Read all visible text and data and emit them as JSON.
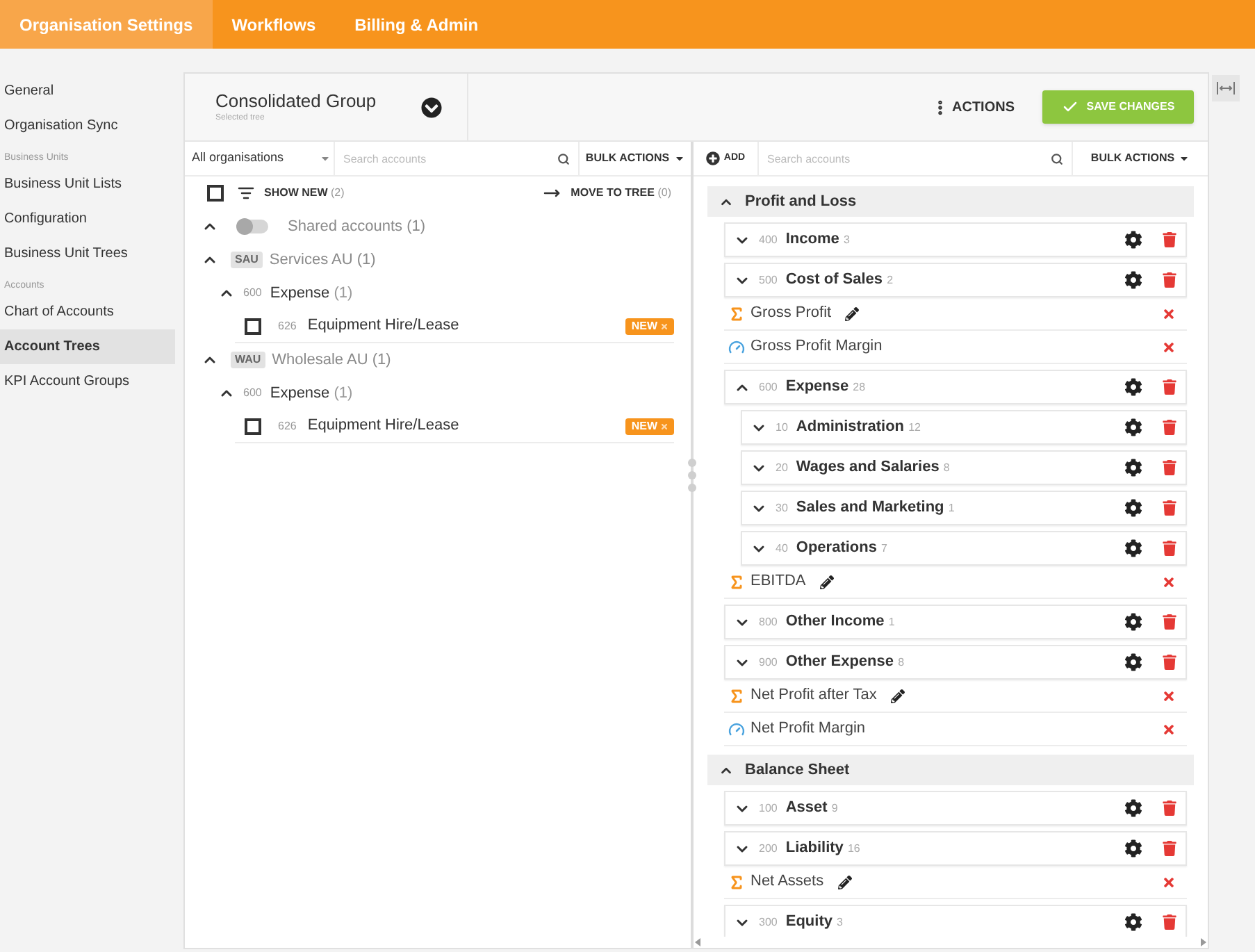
{
  "top_nav": [
    {
      "label": "Organisation Settings",
      "selected": true
    },
    {
      "label": "Workflows",
      "selected": false
    },
    {
      "label": "Billing & Admin",
      "selected": false
    }
  ],
  "sidebar": [
    {
      "kind": "item",
      "label": "General",
      "selected": false
    },
    {
      "kind": "item",
      "label": "Organisation Sync",
      "selected": false
    },
    {
      "kind": "heading",
      "label": "Business Units"
    },
    {
      "kind": "item",
      "label": "Business Unit Lists",
      "selected": false
    },
    {
      "kind": "item",
      "label": "Configuration",
      "selected": false
    },
    {
      "kind": "item",
      "label": "Business Unit Trees",
      "selected": false
    },
    {
      "kind": "heading",
      "label": "Accounts"
    },
    {
      "kind": "item",
      "label": "Chart of Accounts",
      "selected": false
    },
    {
      "kind": "item",
      "label": "Account Trees",
      "selected": true
    },
    {
      "kind": "item",
      "label": "KPI Account Groups",
      "selected": false
    }
  ],
  "tree_selector": {
    "title": "Consolidated Group",
    "subtitle": "Selected tree"
  },
  "header_actions": {
    "actions": "ACTIONS",
    "save": "SAVE CHANGES"
  },
  "left_pane": {
    "org_filter": "All organisations",
    "search": {
      "placeholder": "Search accounts"
    },
    "bulk_actions": "BULK ACTIONS",
    "show_new": {
      "label": "SHOW NEW",
      "count": "(2)",
      "checked": false
    },
    "move_to_tree": {
      "label": "MOVE TO TREE",
      "count": "(0)"
    },
    "tree": [
      {
        "kind": "shared",
        "label": "Shared accounts",
        "count": "(1)",
        "expanded": true,
        "on": false
      },
      {
        "kind": "org",
        "code": "SAU",
        "label": "Services AU",
        "count": "(1)",
        "expanded": true,
        "children": [
          {
            "kind": "category",
            "number": "600",
            "label": "Expense",
            "count": "(1)",
            "expanded": true,
            "children": [
              {
                "kind": "account",
                "number": "626",
                "label": "Equipment Hire/Lease",
                "checked": false,
                "badge": "NEW"
              }
            ]
          }
        ]
      },
      {
        "kind": "org",
        "code": "WAU",
        "label": "Wholesale AU",
        "count": "(1)",
        "expanded": true,
        "children": [
          {
            "kind": "category",
            "number": "600",
            "label": "Expense",
            "count": "(1)",
            "expanded": true,
            "children": [
              {
                "kind": "account",
                "number": "626",
                "label": "Equipment Hire/Lease",
                "checked": false,
                "badge": "NEW"
              }
            ]
          }
        ]
      }
    ]
  },
  "right_pane": {
    "add": "ADD",
    "search": {
      "placeholder": "Search accounts"
    },
    "bulk_actions": "BULK ACTIONS",
    "tree": [
      {
        "kind": "section",
        "label": "Profit and Loss",
        "expanded": true,
        "children": [
          {
            "kind": "account",
            "number": "400",
            "label": "Income",
            "count": "3",
            "expanded": false
          },
          {
            "kind": "account",
            "number": "500",
            "label": "Cost of Sales",
            "count": "2",
            "expanded": false
          },
          {
            "kind": "formula",
            "label": "Gross Profit"
          },
          {
            "kind": "ratio",
            "label": "Gross Profit Margin"
          },
          {
            "kind": "account",
            "number": "600",
            "label": "Expense",
            "count": "28",
            "expanded": true,
            "children": [
              {
                "kind": "account",
                "number": "10",
                "label": "Administration",
                "count": "12",
                "expanded": false
              },
              {
                "kind": "account",
                "number": "20",
                "label": "Wages and Salaries",
                "count": "8",
                "expanded": false
              },
              {
                "kind": "account",
                "number": "30",
                "label": "Sales and Marketing",
                "count": "1",
                "expanded": false
              },
              {
                "kind": "account",
                "number": "40",
                "label": "Operations",
                "count": "7",
                "expanded": false
              }
            ]
          },
          {
            "kind": "formula",
            "label": "EBITDA"
          },
          {
            "kind": "account",
            "number": "800",
            "label": "Other Income",
            "count": "1",
            "expanded": false
          },
          {
            "kind": "account",
            "number": "900",
            "label": "Other Expense",
            "count": "8",
            "expanded": false
          },
          {
            "kind": "formula",
            "label": "Net Profit after Tax"
          },
          {
            "kind": "ratio",
            "label": "Net Profit Margin"
          }
        ]
      },
      {
        "kind": "section",
        "label": "Balance Sheet",
        "expanded": true,
        "children": [
          {
            "kind": "account",
            "number": "100",
            "label": "Asset",
            "count": "9",
            "expanded": false
          },
          {
            "kind": "account",
            "number": "200",
            "label": "Liability",
            "count": "16",
            "expanded": false
          },
          {
            "kind": "formula",
            "label": "Net Assets"
          },
          {
            "kind": "account",
            "number": "300",
            "label": "Equity",
            "count": "3",
            "expanded": false
          }
        ]
      }
    ]
  }
}
